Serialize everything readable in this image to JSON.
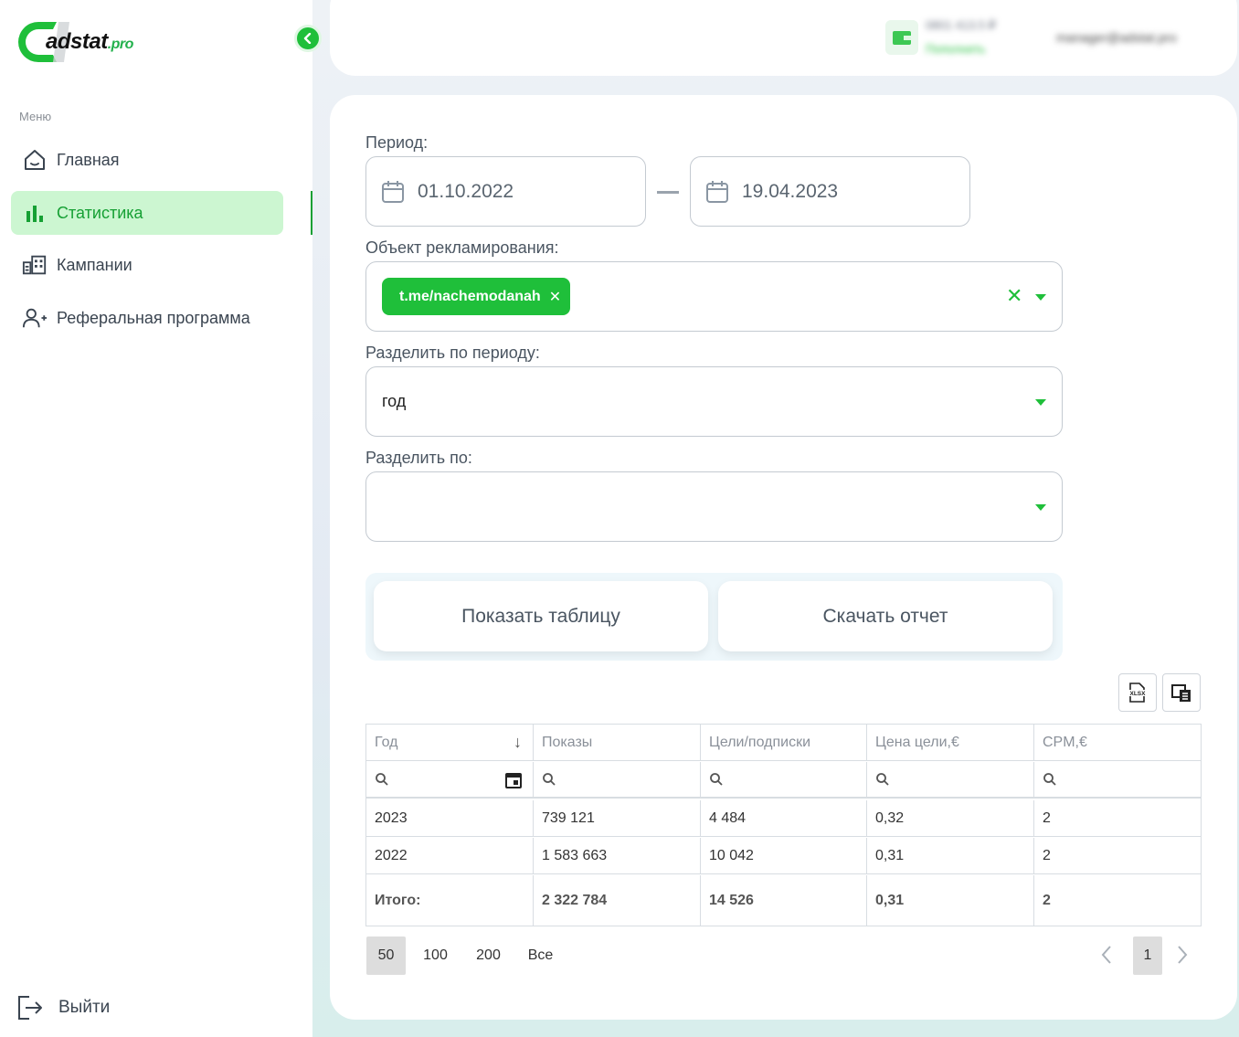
{
  "brand": {
    "logo_text": "adstat",
    "logo_suffix": ".pro"
  },
  "sidebar": {
    "menu_label": "Меню",
    "items": [
      {
        "label": "Главная",
        "icon": "home-icon"
      },
      {
        "label": "Статистика",
        "icon": "bar-chart-icon",
        "active": true
      },
      {
        "label": "Кампании",
        "icon": "campaigns-icon"
      },
      {
        "label": "Реферальная программа",
        "icon": "user-plus-icon"
      }
    ],
    "logout_label": "Выйти"
  },
  "header": {
    "wallet_line1": "0801 413.5 ₽",
    "wallet_line2": "Пополнить",
    "user_email": "manager@adstat.pro"
  },
  "filters": {
    "period_label": "Период:",
    "date_from": "01.10.2022",
    "date_to": "19.04.2023",
    "object_label": "Объект рекламирования:",
    "object_chip": "t.me/nachemodanah",
    "split_period_label": "Разделить по периоду:",
    "split_period_value": "год",
    "split_by_label": "Разделить по:",
    "split_by_value": ""
  },
  "actions": {
    "show_table": "Показать таблицу",
    "download_report": "Скачать отчет"
  },
  "table": {
    "columns": [
      "Год",
      "Показы",
      "Цели/подписки",
      "Цена цели,€",
      "CPM,€"
    ],
    "rows": [
      [
        "2023",
        "739 121",
        "4 484",
        "0,32",
        "2"
      ],
      [
        "2022",
        "1 583 663",
        "10 042",
        "0,31",
        "2"
      ]
    ],
    "total": [
      "Итого:",
      "2 322 784",
      "14 526",
      "0,31",
      "2"
    ]
  },
  "pagination": {
    "page_sizes": [
      "50",
      "100",
      "200",
      "Все"
    ],
    "selected_size": "50",
    "current_page": "1"
  },
  "colors": {
    "accent": "#1fbf3a",
    "active_bg": "#ccf6d1",
    "active_text": "#16a034"
  }
}
